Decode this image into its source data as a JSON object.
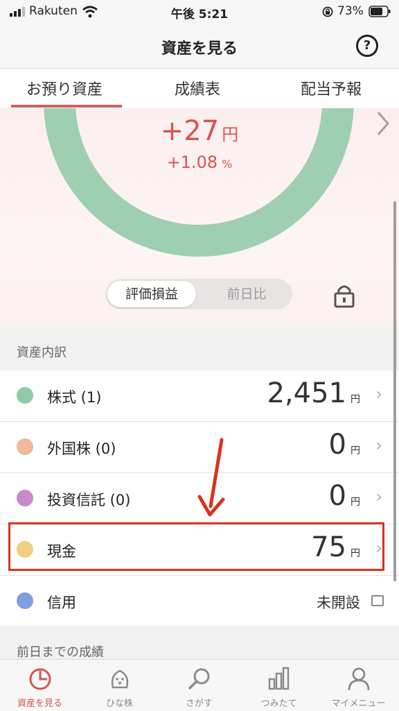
{
  "status_bar": {
    "carrier": "Rakuten",
    "time": "午後 5:21",
    "battery": "73%"
  },
  "header": {
    "title": "資産を見る",
    "help_label": "?"
  },
  "tabs": [
    {
      "label": "お預り資産",
      "active": true
    },
    {
      "label": "成績表"
    },
    {
      "label": "配当予報"
    }
  ],
  "summary": {
    "gain_value": "+27",
    "gain_unit": "円",
    "gain_pct": "+1.08",
    "pct_unit": "%",
    "ring_color": "#9fcfb3"
  },
  "toggle": {
    "active": "評価損益",
    "inactive": "前日比"
  },
  "breakdown": {
    "section_title": "資産内訳",
    "rows": [
      {
        "label": "株式 (1)",
        "value": "2,451",
        "unit": "円",
        "color": "#8fcba8"
      },
      {
        "label": "外国株 (0)",
        "value": "0",
        "unit": "円",
        "color": "#f0b99a"
      },
      {
        "label": "投資信託 (0)",
        "value": "0",
        "unit": "円",
        "color": "#c889c8"
      },
      {
        "label": "現金",
        "value": "75",
        "unit": "円",
        "color": "#f0cf80"
      },
      {
        "label": "信用",
        "status": "未開設",
        "color": "#7f9fe0"
      }
    ]
  },
  "next_section": {
    "title": "前日までの成績"
  },
  "tab_bar": [
    {
      "label": "資産を見る",
      "icon": "pie-chart-icon",
      "active": true
    },
    {
      "label": "ひな株",
      "icon": "chick-icon"
    },
    {
      "label": "さがす",
      "icon": "search-icon"
    },
    {
      "label": "つみたて",
      "icon": "bar-chart-icon"
    },
    {
      "label": "マイメニュー",
      "icon": "person-icon"
    }
  ]
}
